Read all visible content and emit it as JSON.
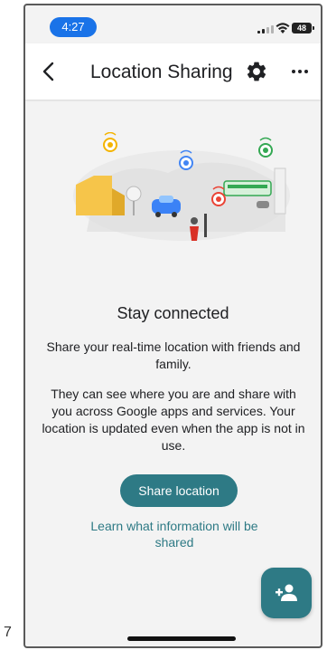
{
  "edge_label": "7",
  "status_bar": {
    "time": "4:27",
    "battery": "48",
    "colors": {
      "time_pill": "#1a73e8"
    }
  },
  "app_bar": {
    "title": "Location Sharing",
    "icons": {
      "back": "chevron-left-icon",
      "settings": "gear-icon",
      "more": "more-horizontal-icon"
    }
  },
  "content": {
    "illustration": "location-sharing-illustration",
    "heading": "Stay connected",
    "paragraph1": "Share your real-time location with friends and family.",
    "paragraph2": "They can see where you are and share with you across Google apps and services. Your location is updated even when the app is not in use.",
    "share_button": "Share location",
    "learn_link": "Learn what information will be shared"
  },
  "fab": {
    "icon": "add-person-icon"
  },
  "colors": {
    "accent": "#2e7a85",
    "background": "#f3f3f3"
  }
}
